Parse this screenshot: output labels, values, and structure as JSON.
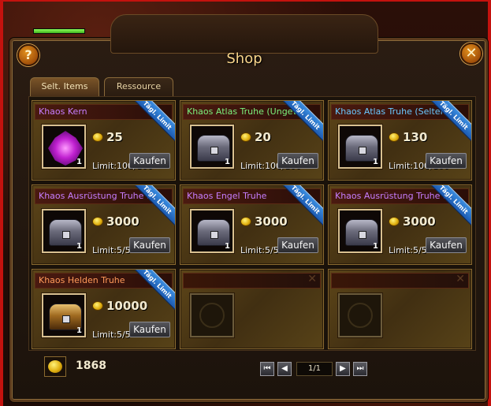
{
  "window": {
    "title": "Shop"
  },
  "tabs": [
    {
      "label": "Selt. Items",
      "active": true
    },
    {
      "label": "Ressource",
      "active": false
    }
  ],
  "colors": {
    "purple_name": "#c77dff",
    "green_name": "#7cf07c",
    "blue_name": "#6ac8ff",
    "orange_name": "#ff9a5a"
  },
  "items": [
    {
      "name": "Khaos Kern",
      "name_color": "#c77dff",
      "ribbon": "Tägl. Limit",
      "price": "25",
      "qty": "1",
      "limit": "Limit:100/100",
      "buy": "Kaufen",
      "icon": "purple-crystal-icon"
    },
    {
      "name": "Khaos Atlas Truhe (Ungew",
      "name_color": "#7cf07c",
      "ribbon": "Tägl. Limit",
      "price": "20",
      "qty": "1",
      "limit": "Limit:100/100",
      "buy": "Kaufen",
      "icon": "green-chest-icon"
    },
    {
      "name": "Khaos Atlas Truhe (Selten)",
      "name_color": "#6ac8ff",
      "ribbon": "Tägl. Limit",
      "price": "130",
      "qty": "1",
      "limit": "Limit:100/100",
      "buy": "Kaufen",
      "icon": "cyan-chest-icon"
    },
    {
      "name": "Khaos Ausrüstung Truhe I",
      "name_color": "#c77dff",
      "ribbon": "Tägl. Limit",
      "price": "3000",
      "qty": "1",
      "limit": "Limit:5/5",
      "buy": "Kaufen",
      "icon": "purple-chest-icon"
    },
    {
      "name": "Khaos Engel Truhe",
      "name_color": "#c77dff",
      "ribbon": "Tägl. Limit",
      "price": "3000",
      "qty": "1",
      "limit": "Limit:5/5",
      "buy": "Kaufen",
      "icon": "purple-chest-icon"
    },
    {
      "name": "Khaos Ausrüstung Truhe I",
      "name_color": "#c77dff",
      "ribbon": "Tägl. Limit",
      "price": "3000",
      "qty": "1",
      "limit": "Limit:5/5",
      "buy": "Kaufen",
      "icon": "purple-chest-icon"
    },
    {
      "name": "Khaos Helden Truhe",
      "name_color": "#ff9a5a",
      "ribbon": "Tägl. Limit",
      "price": "10000",
      "qty": "1",
      "limit": "Limit:5/5",
      "buy": "Kaufen",
      "icon": "orange-chest-icon"
    }
  ],
  "footer": {
    "balance": "1868",
    "page": "1/1"
  },
  "buttons": {
    "help": "?",
    "close": "✕",
    "first": "⏮",
    "prev": "◀",
    "next": "▶",
    "last": "⏭"
  }
}
